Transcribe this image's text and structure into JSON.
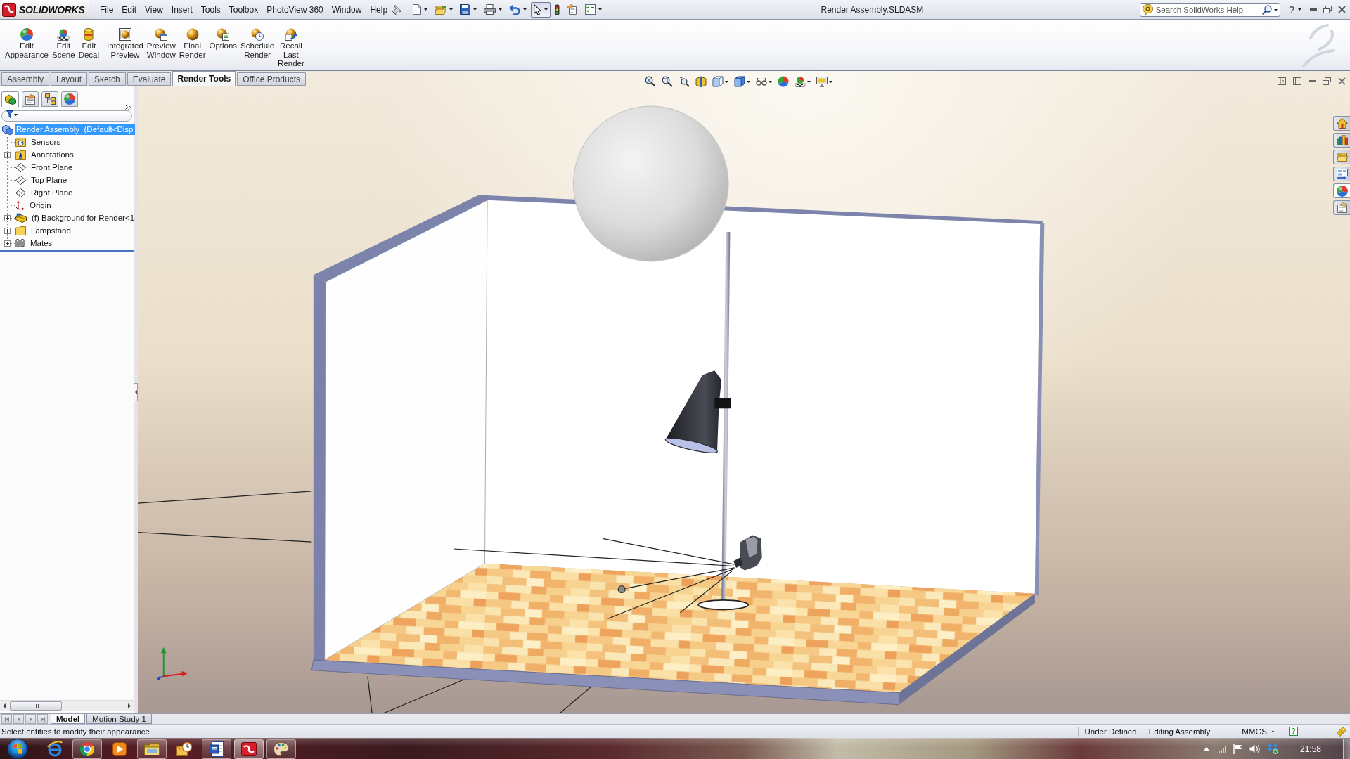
{
  "title_bar": {
    "logo": "SOLIDWORKS",
    "menus": [
      "File",
      "Edit",
      "View",
      "Insert",
      "Tools",
      "Toolbox",
      "PhotoView 360",
      "Window",
      "Help"
    ],
    "document_title": "Render Assembly.SLDASM",
    "help_search": {
      "placeholder": "Search SolidWorks Help"
    },
    "help_button": "?"
  },
  "quick_access": [
    {
      "kind": "new",
      "dropdown": true,
      "pressed": false
    },
    {
      "kind": "open",
      "dropdown": true,
      "pressed": false
    },
    {
      "kind": "save",
      "dropdown": true,
      "pressed": false
    },
    {
      "kind": "print",
      "dropdown": true,
      "pressed": false
    },
    {
      "kind": "undo",
      "dropdown": true,
      "pressed": false
    },
    {
      "kind": "select",
      "dropdown": true,
      "pressed": true
    },
    {
      "kind": "rebuild",
      "dropdown": false,
      "pressed": false
    },
    {
      "kind": "properties",
      "dropdown": false,
      "pressed": false
    },
    {
      "kind": "options",
      "dropdown": true,
      "pressed": false
    }
  ],
  "ribbon": {
    "groups": [
      [
        {
          "kind": "appearance",
          "label": "Edit\nAppearance"
        },
        {
          "kind": "scene",
          "label": "Edit\nScene"
        },
        {
          "kind": "decal",
          "label": "Edit\nDecal"
        }
      ],
      [
        {
          "kind": "integrated_preview",
          "label": "Integrated\nPreview"
        },
        {
          "kind": "preview_window",
          "label": "Preview\nWindow"
        },
        {
          "kind": "final_render",
          "label": "Final\nRender"
        },
        {
          "kind": "options",
          "label": "Options"
        },
        {
          "kind": "schedule",
          "label": "Schedule\nRender"
        },
        {
          "kind": "recall",
          "label": "Recall\nLast\nRender"
        }
      ]
    ]
  },
  "command_tabs": [
    {
      "label": "Assembly",
      "selected": false
    },
    {
      "label": "Layout",
      "selected": false
    },
    {
      "label": "Sketch",
      "selected": false
    },
    {
      "label": "Evaluate",
      "selected": false
    },
    {
      "label": "Render Tools",
      "selected": true
    },
    {
      "label": "Office Products",
      "selected": false
    }
  ],
  "feature_manager": {
    "tabs": [
      {
        "kind": "features",
        "selected": true
      },
      {
        "kind": "properties",
        "selected": false
      },
      {
        "kind": "configurations",
        "selected": false
      },
      {
        "kind": "display",
        "selected": false
      }
    ],
    "tree": {
      "label": "Render Assembly  (Default<Disp",
      "kind": "assembly",
      "selected": true,
      "children": [
        {
          "label": "Sensors",
          "kind": "sensors",
          "expandable": false,
          "selected": false
        },
        {
          "label": "Annotations",
          "kind": "annotations",
          "expandable": true,
          "selected": false
        },
        {
          "label": "Front Plane",
          "kind": "plane",
          "expandable": false,
          "selected": false
        },
        {
          "label": "Top Plane",
          "kind": "plane",
          "expandable": false,
          "selected": false
        },
        {
          "label": "Right Plane",
          "kind": "plane",
          "expandable": false,
          "selected": false
        },
        {
          "label": "Origin",
          "kind": "origin",
          "expandable": false,
          "selected": false
        },
        {
          "label": "(f) Background for Render<1",
          "kind": "part",
          "expandable": true,
          "selected": false
        },
        {
          "label": "Lampstand",
          "kind": "folder",
          "expandable": true,
          "selected": false
        },
        {
          "label": "Mates",
          "kind": "mates",
          "expandable": true,
          "selected": false
        }
      ]
    }
  },
  "task_pane_tabs": [
    {
      "kind": "home",
      "selected": false
    },
    {
      "kind": "library",
      "selected": false
    },
    {
      "kind": "explorer",
      "selected": false
    },
    {
      "kind": "palette",
      "selected": false
    },
    {
      "kind": "appearances",
      "selected": true
    },
    {
      "kind": "custom_properties",
      "selected": false
    }
  ],
  "bottom_tabs": [
    {
      "label": "Model",
      "selected": true
    },
    {
      "label": "Motion Study 1",
      "selected": false
    }
  ],
  "status_bar": {
    "message": "Select entities to modify their appearance",
    "fields": [
      "Under Defined",
      "Editing Assembly"
    ],
    "units": "MMGS",
    "help": "?"
  },
  "taskbar": {
    "apps": [
      {
        "kind": "web_browser",
        "running": false,
        "active": false
      },
      {
        "kind": "browser",
        "running": true,
        "active": false
      },
      {
        "kind": "media_player",
        "running": false,
        "active": false
      },
      {
        "kind": "file_explorer",
        "running": true,
        "active": false
      },
      {
        "kind": "mail",
        "running": false,
        "active": false
      },
      {
        "kind": "word_processor",
        "running": true,
        "active": false
      },
      {
        "kind": "cad",
        "running": true,
        "active": true
      },
      {
        "kind": "paint",
        "running": true,
        "active": false
      }
    ],
    "clock": "21:58"
  }
}
